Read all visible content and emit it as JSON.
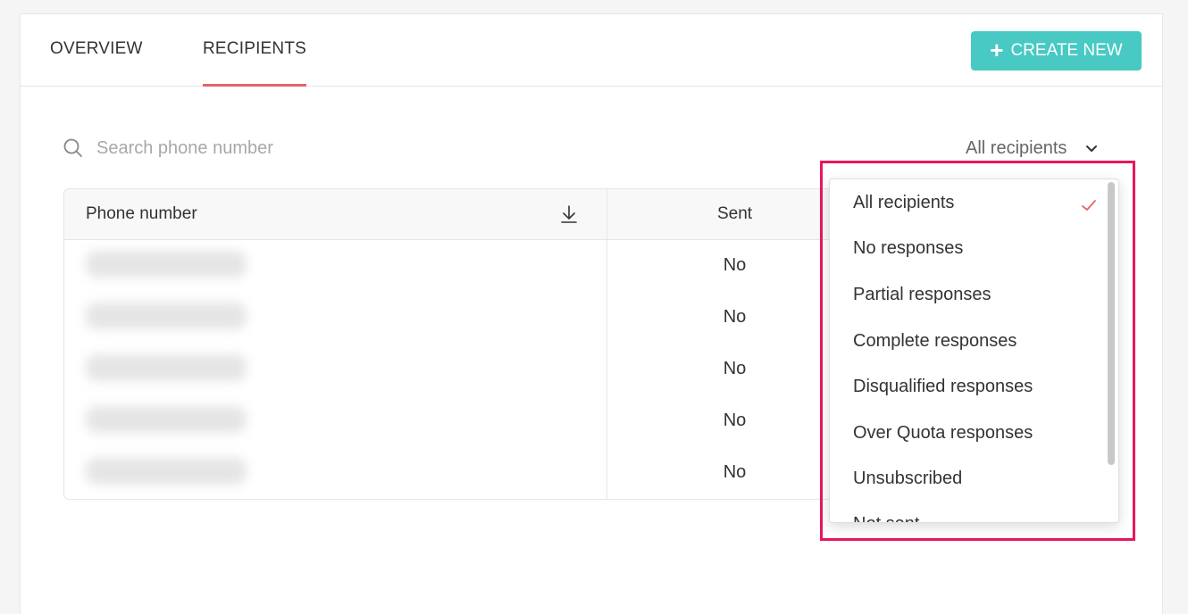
{
  "tabs": [
    {
      "label": "OVERVIEW",
      "active": false
    },
    {
      "label": "RECIPIENTS",
      "active": true
    }
  ],
  "create_button": {
    "label": "CREATE NEW",
    "icon": "plus-icon",
    "color": "#48c9c3"
  },
  "search": {
    "placeholder": "Search phone number",
    "value": "",
    "icon": "search-icon"
  },
  "filter": {
    "selected": "All recipients",
    "icon": "chevron-down-icon"
  },
  "table": {
    "columns": [
      "Phone number",
      "Sent"
    ],
    "download_icon": "download-icon",
    "rows": [
      {
        "sent": "No"
      },
      {
        "sent": "No"
      },
      {
        "sent": "No"
      },
      {
        "sent": "No"
      },
      {
        "sent": "No"
      }
    ]
  },
  "dropdown": {
    "options": [
      "All recipients",
      "No responses",
      "Partial responses",
      "Complete responses",
      "Disqualified responses",
      "Over Quota responses",
      "Unsubscribed",
      "Not sent"
    ],
    "selected_index": 0,
    "check_icon": "check-icon",
    "highlight_color": "#e8175d"
  },
  "colors": {
    "accent": "#48c9c3",
    "tab_underline": "#e8636a",
    "check": "#e8636a"
  }
}
